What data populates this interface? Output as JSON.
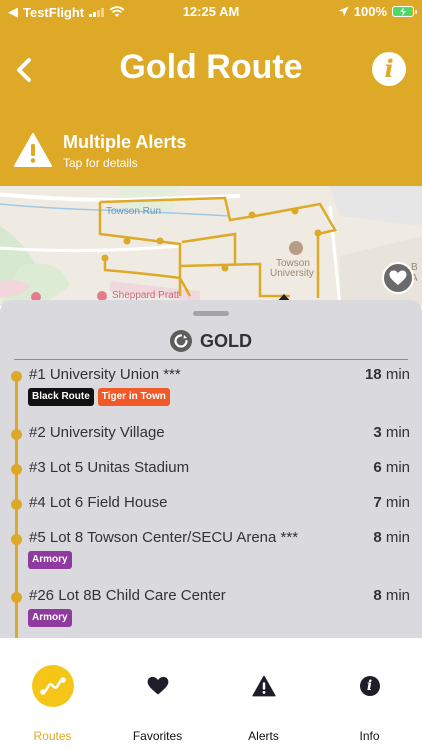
{
  "status_bar": {
    "back_app": "TestFlight",
    "time": "12:25 AM",
    "battery": "100%"
  },
  "header": {
    "title": "Gold Route",
    "alert_title": "Multiple Alerts",
    "alert_subtitle": "Tap for details"
  },
  "map": {
    "labels": {
      "towson_run": "Towson Run",
      "towson_university_1": "Towson",
      "towson_university_2": "University",
      "sheppard_pratt": "Sheppard Pratt",
      "edge_label": "B\nA"
    }
  },
  "sheet": {
    "route_name": "GOLD",
    "stops": [
      {
        "name": "#1 University Union ***",
        "minutes": "18",
        "unit": "min",
        "tags": [
          {
            "label": "Black Route",
            "color": "#111111"
          },
          {
            "label": "Tiger in Town",
            "color": "#F05A28"
          }
        ]
      },
      {
        "name": "#2 University Village",
        "minutes": "3",
        "unit": "min",
        "tags": []
      },
      {
        "name": "#3 Lot 5 Unitas Stadium",
        "minutes": "6",
        "unit": "min",
        "tags": []
      },
      {
        "name": "#4 Lot 6 Field House",
        "minutes": "7",
        "unit": "min",
        "tags": []
      },
      {
        "name": "#5 Lot 8 Towson Center/SECU Arena ***",
        "minutes": "8",
        "unit": "min",
        "tags": [
          {
            "label": "Armory",
            "color": "#8E3A9E"
          }
        ]
      },
      {
        "name": "#26 Lot 8B Child Care Center",
        "minutes": "8",
        "unit": "min",
        "tags": [
          {
            "label": "Armory",
            "color": "#8E3A9E"
          }
        ]
      }
    ]
  },
  "tabs": [
    {
      "label": "Routes",
      "active": true
    },
    {
      "label": "Favorites",
      "active": false
    },
    {
      "label": "Alerts",
      "active": false
    },
    {
      "label": "Info",
      "active": false
    }
  ],
  "colors": {
    "brand_gold": "#DDA927",
    "routes_circle": "#F5C518",
    "sheet_bg": "#D9D9DE"
  }
}
